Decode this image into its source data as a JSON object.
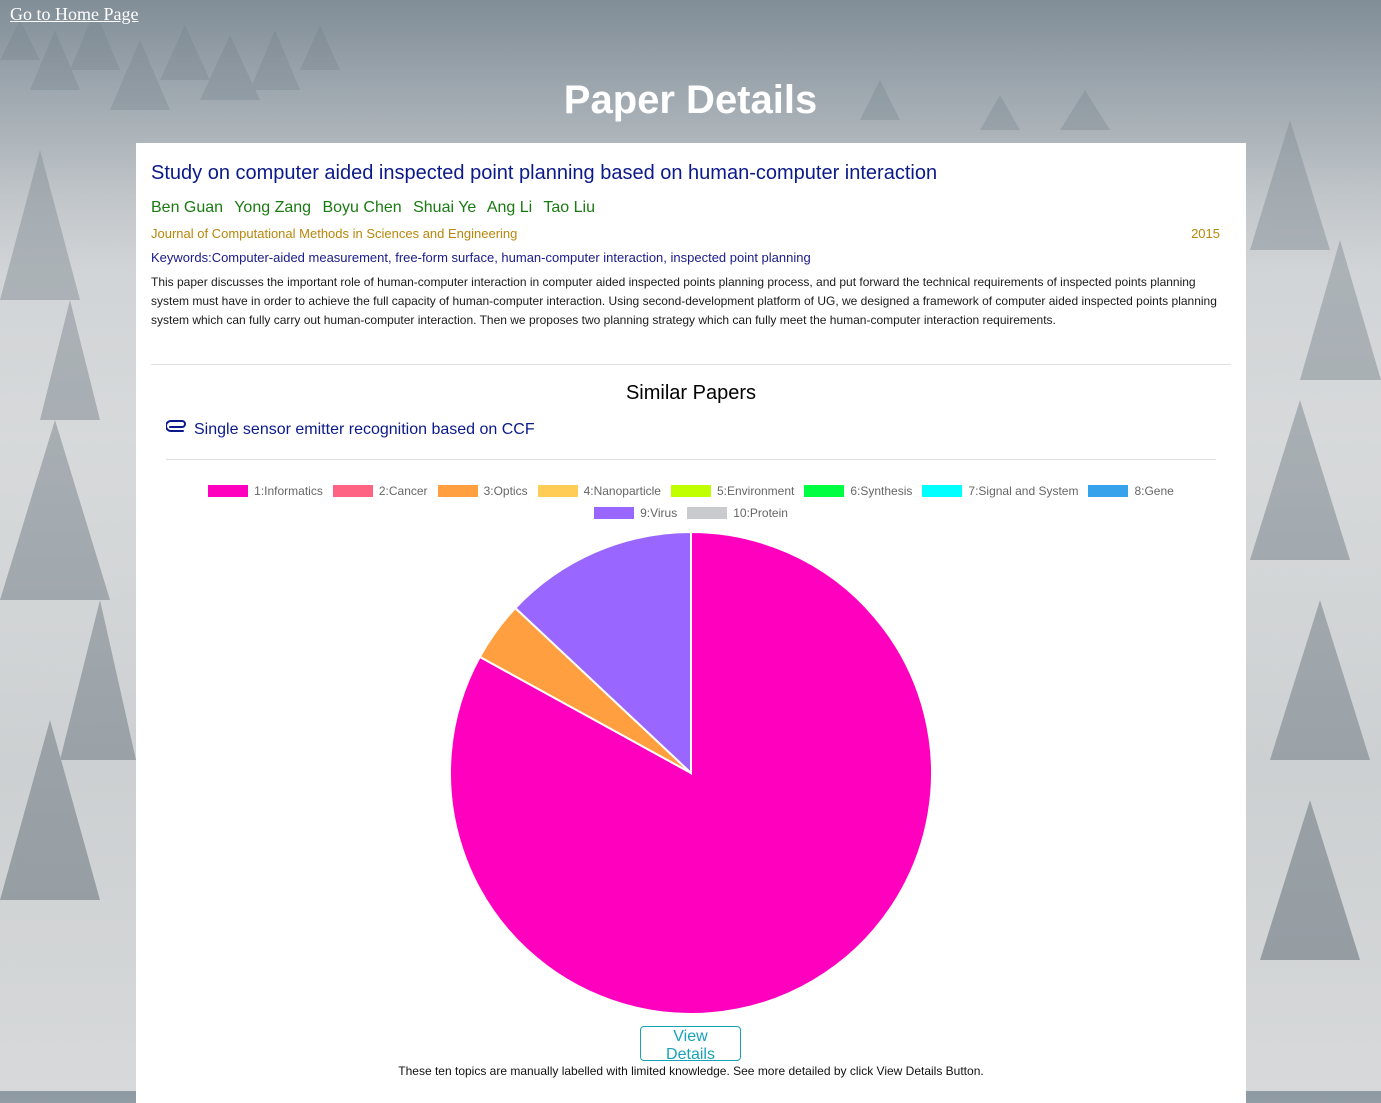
{
  "nav": {
    "home_link": "Go to Home Page"
  },
  "header": {
    "title": "Paper Details"
  },
  "paper": {
    "title": "Study on computer aided inspected point planning based on human-computer interaction",
    "authors": [
      "Ben Guan",
      "Yong Zang",
      "Boyu Chen",
      "Shuai Ye",
      "Ang Li",
      "Tao Liu"
    ],
    "journal": "Journal of Computational Methods in Sciences and Engineering",
    "year": "2015",
    "keywords": "Keywords:Computer-aided measurement, free-form surface, human-computer interaction, inspected point planning",
    "abstract": "This paper discusses the important role of human-computer interaction in computer aided inspected points planning process, and put forward the technical requirements of inspected points planning system must have in order to achieve the full capacity of human-computer interaction. Using second-development platform of UG, we designed a framework of computer aided inspected points planning system which can fully carry out human-computer interaction. Then we proposes two planning strategy which can fully meet the human-computer interaction requirements."
  },
  "similar": {
    "heading": "Similar Papers",
    "items": [
      {
        "title": "Single sensor emitter recognition based on CCF",
        "icon": "paperclip-icon"
      }
    ]
  },
  "chart_data": {
    "type": "pie",
    "categories": [
      "1:Informatics",
      "2:Cancer",
      "3:Optics",
      "4:Nanoparticle",
      "5:Environment",
      "6:Synthesis",
      "7:Signal and System",
      "8:Gene",
      "9:Virus",
      "10:Protein"
    ],
    "values": [
      83,
      0,
      4,
      0,
      0,
      0,
      0,
      0,
      13,
      0
    ],
    "colors": [
      "#ff00bf",
      "#ff6384",
      "#ff9f40",
      "#ffcd56",
      "#bfff00",
      "#00ff40",
      "#00ffff",
      "#36a2eb",
      "#9966ff",
      "#c9cbcf"
    ],
    "legend_position": "top"
  },
  "actions": {
    "view_details": "View Details"
  },
  "footer": {
    "note": "These ten topics are manually labelled with limited knowledge. See more detailed by click View Details Button."
  }
}
